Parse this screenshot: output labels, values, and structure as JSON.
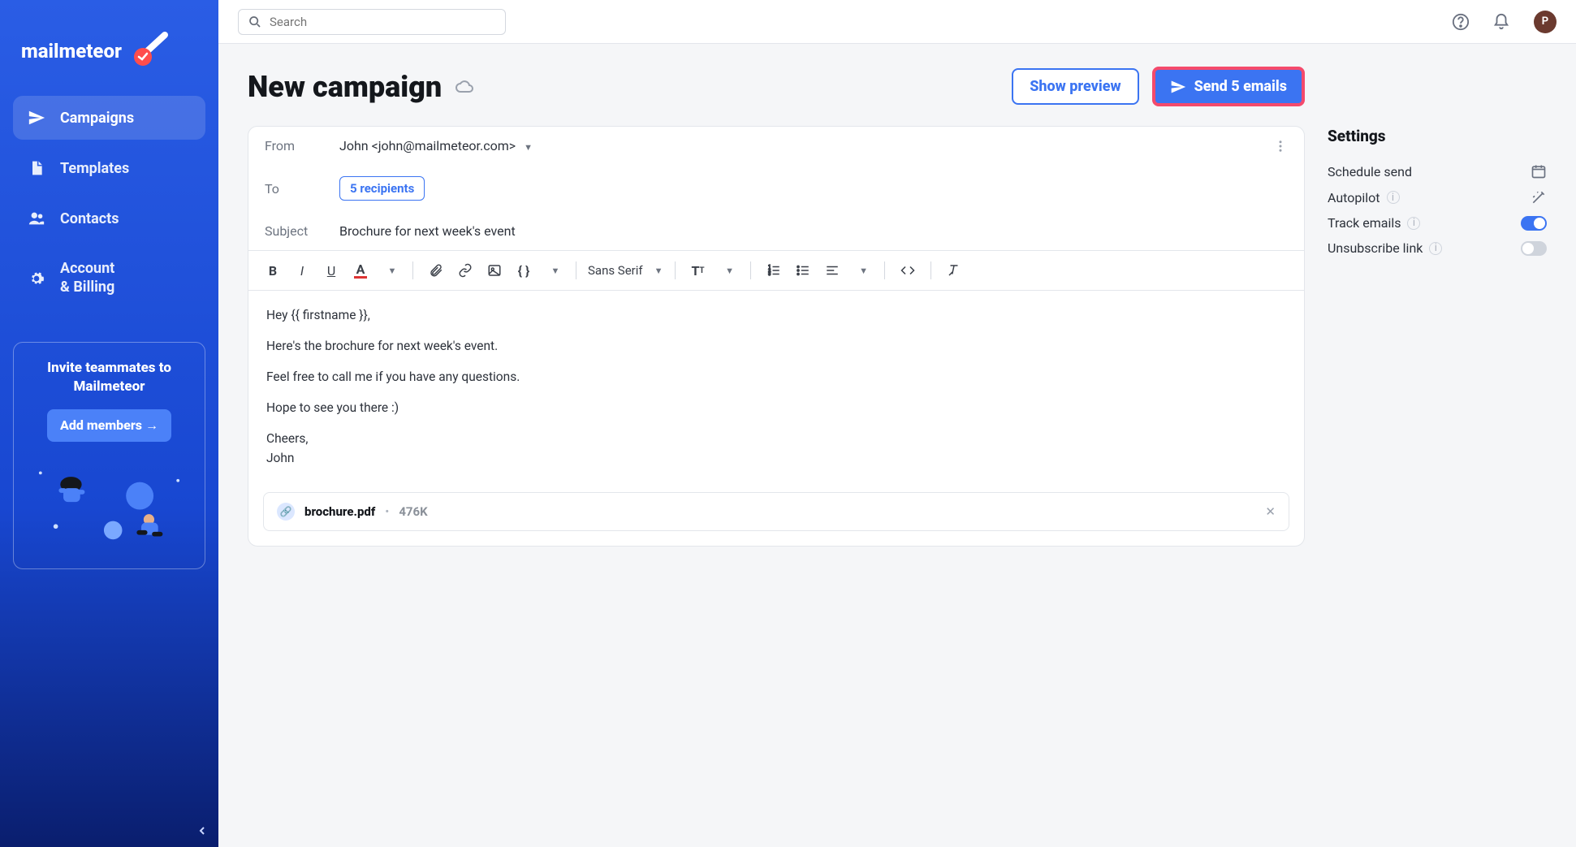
{
  "brand": {
    "name": "mailmeteor"
  },
  "search": {
    "placeholder": "Search"
  },
  "topbar": {
    "avatar_initial": "P"
  },
  "sidebar": {
    "items": [
      {
        "label": "Campaigns"
      },
      {
        "label": "Templates"
      },
      {
        "label": "Contacts"
      },
      {
        "label": "Account & Billing"
      }
    ],
    "invite": {
      "title_line1": "Invite teammates to",
      "title_line2": "Mailmeteor",
      "button": "Add members →"
    }
  },
  "page": {
    "title": "New campaign",
    "preview_button": "Show preview",
    "send_button": "Send 5 emails"
  },
  "compose": {
    "from_label": "From",
    "from_value": "John <john@mailmeteor.com>",
    "to_label": "To",
    "to_chip": "5 recipients",
    "subject_label": "Subject",
    "subject_value": "Brochure for next week's event",
    "font": "Sans Serif",
    "body": {
      "p1": "Hey {{ firstname }},",
      "p2": "Here's the brochure for next week's event.",
      "p3": "Feel free to call me if you have any questions.",
      "p4": "Hope to see you there :)",
      "p5a": "Cheers,",
      "p5b": "John"
    },
    "attachment": {
      "name": "brochure.pdf",
      "size": "476K"
    }
  },
  "settings": {
    "title": "Settings",
    "schedule": "Schedule send",
    "autopilot": "Autopilot",
    "track": "Track emails",
    "unsubscribe": "Unsubscribe link",
    "track_on": true,
    "unsubscribe_on": false
  }
}
